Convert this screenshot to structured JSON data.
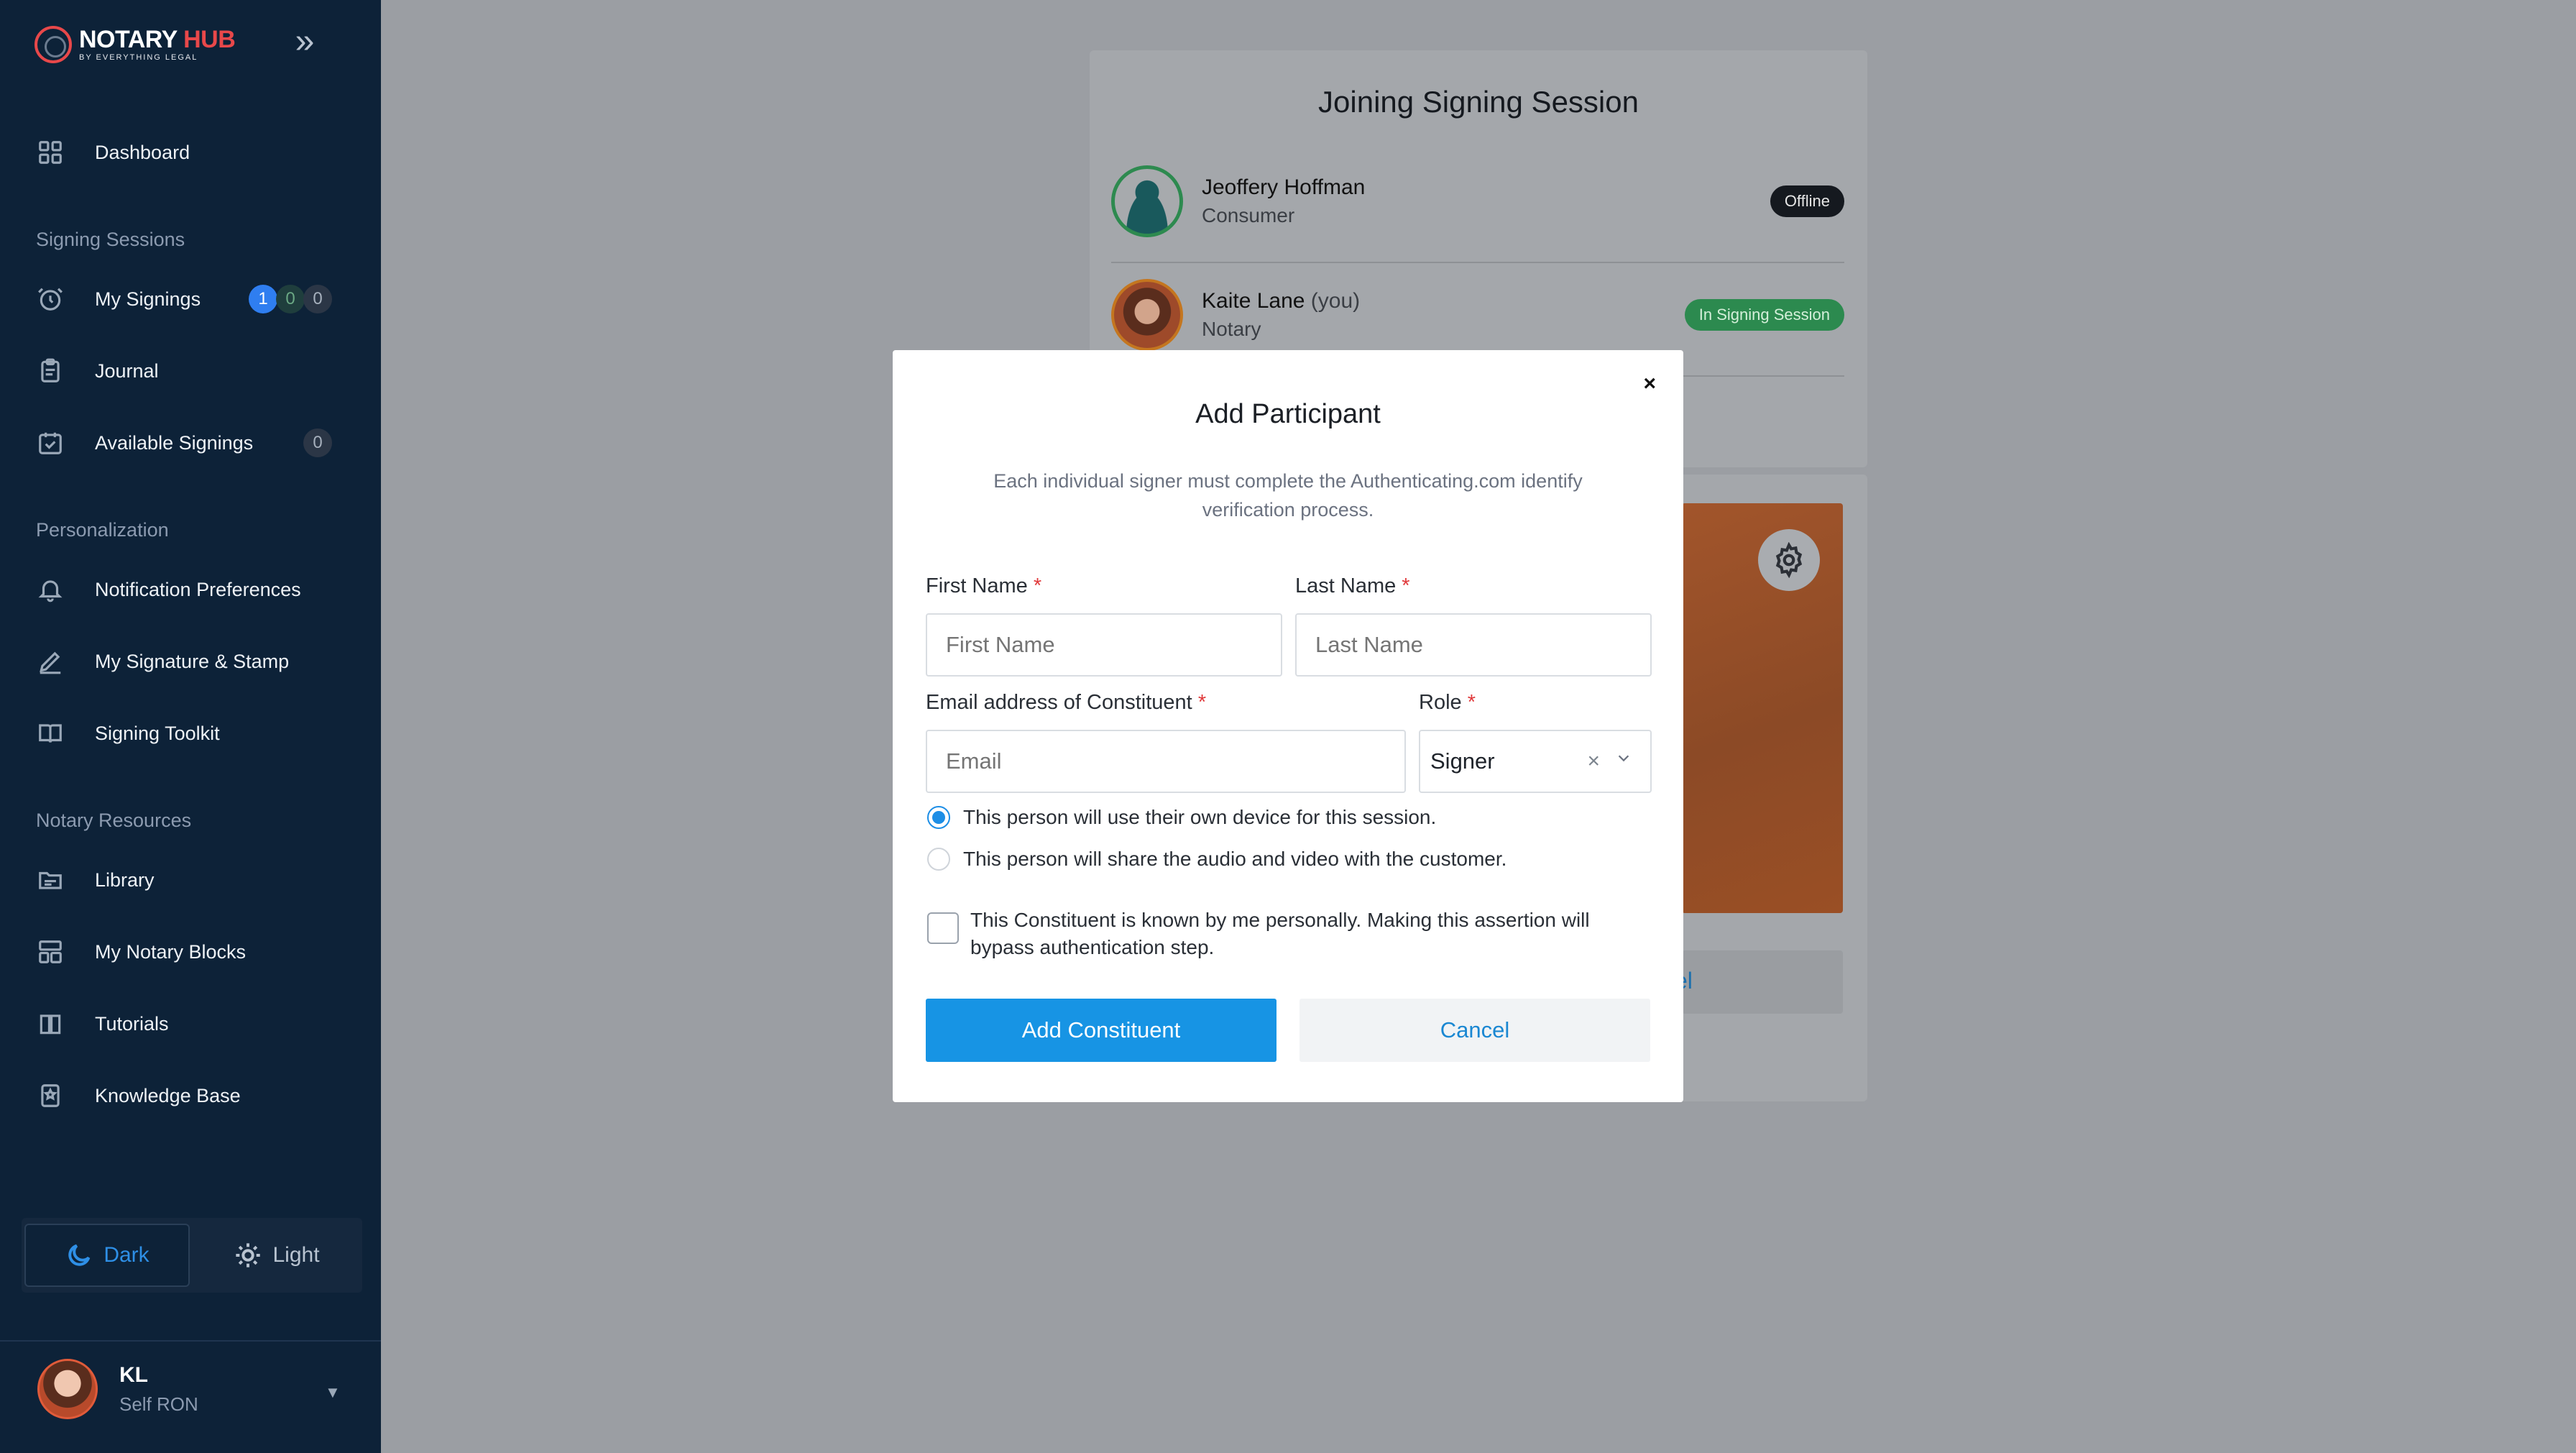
{
  "brand": {
    "name": "NOTARY",
    "name_accent": "HUB",
    "tagline": "BY EVERYTHING LEGAL",
    "accent_color": "#e8484a"
  },
  "sidebar": {
    "dashboard": "Dashboard",
    "sections": {
      "signing_sessions": "Signing Sessions",
      "personalization": "Personalization",
      "notary_resources": "Notary Resources"
    },
    "items": {
      "my_signings": "My Signings",
      "my_signings_counts": [
        "1",
        "0",
        "0"
      ],
      "journal": "Journal",
      "available_signings": "Available Signings",
      "available_signings_count": "0",
      "notification_preferences": "Notification Preferences",
      "signature_stamp": "My Signature & Stamp",
      "signing_toolkit": "Signing Toolkit",
      "library": "Library",
      "notary_blocks": "My Notary Blocks",
      "tutorials": "Tutorials",
      "knowledge_base": "Knowledge Base"
    },
    "theme": {
      "dark": "Dark",
      "light": "Light",
      "selected": "Dark"
    },
    "profile": {
      "initials": "KL",
      "role": "Self RON"
    }
  },
  "session": {
    "title": "Joining Signing Session",
    "participants": [
      {
        "name": "Jeoffery Hoffman",
        "suffix": "",
        "role": "Consumer",
        "status": "Offline"
      },
      {
        "name": "Kaite Lane",
        "suffix": "(you)",
        "role": "Notary",
        "status": "In Signing Session"
      }
    ],
    "partial_button_text": "el"
  },
  "modal": {
    "title": "Add Participant",
    "close": "×",
    "description": "Each individual signer must complete the Authenticating.com identify verification process.",
    "first_name": {
      "label": "First Name",
      "required": "*",
      "placeholder": "First Name",
      "value": ""
    },
    "last_name": {
      "label": "Last Name",
      "required": "*",
      "placeholder": "Last Name",
      "value": ""
    },
    "email": {
      "label": "Email address of Constituent",
      "required": "*",
      "placeholder": "Email",
      "value": ""
    },
    "role": {
      "label": "Role",
      "required": "*",
      "value": "Signer",
      "clear": "×"
    },
    "device_options": [
      {
        "label": "This person will use their own device for this session.",
        "selected": true
      },
      {
        "label": "This person will share the audio and video with the customer.",
        "selected": false
      }
    ],
    "known_personally": {
      "label": "This Constituent is known by me personally. Making this assertion will bypass authentication step.",
      "checked": false
    },
    "buttons": {
      "submit": "Add Constituent",
      "cancel": "Cancel"
    },
    "colors": {
      "primary": "#1794e4",
      "required": "#e0393b"
    }
  }
}
